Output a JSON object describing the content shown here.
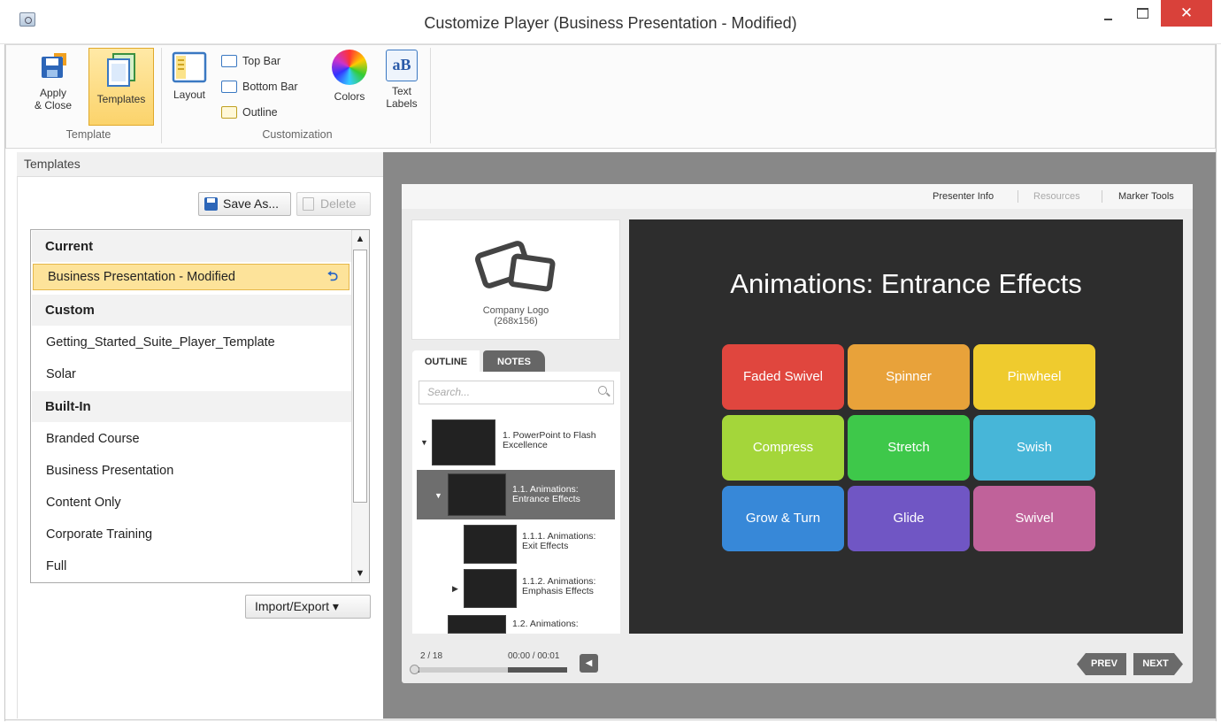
{
  "window": {
    "title": "Customize Player (Business Presentation - Modified)",
    "close_glyph": "✕"
  },
  "ribbon": {
    "apply_close": "Apply\n& Close",
    "templates": "Templates",
    "layout": "Layout",
    "top_bar": "Top Bar",
    "bottom_bar": "Bottom Bar",
    "outline": "Outline",
    "colors": "Colors",
    "text_labels": "Text\nLabels",
    "group_template": "Template",
    "group_customization": "Customization"
  },
  "templates_panel": {
    "title": "Templates",
    "save_as": "Save As...",
    "delete": "Delete",
    "import_export": "Import/Export ▾",
    "sections": {
      "current": "Current",
      "custom": "Custom",
      "built_in": "Built-In"
    },
    "current_item": "Business Presentation - Modified",
    "custom_items": [
      "Getting_Started_Suite_Player_Template",
      "Solar"
    ],
    "built_in_items": [
      "Branded Course",
      "Business Presentation",
      "Content Only",
      "Corporate Training",
      "Full"
    ]
  },
  "player": {
    "top_tabs": [
      "Presenter Info",
      "Resources",
      "Marker Tools"
    ],
    "logo_label": "Company Logo\n(268x156)",
    "tab_outline": "OUTLINE",
    "tab_notes": "NOTES",
    "search_placeholder": "Search...",
    "outline_items": [
      "1. PowerPoint to Flash\nExcellence",
      "1.1. Animations:\nEntrance Effects",
      "1.1.1. Animations:\nExit Effects",
      "1.1.2. Animations:\nEmphasis Effects",
      "1.2. Animations:"
    ],
    "slide_title": "Animations: Entrance Effects",
    "tiles": [
      {
        "label": "Faded Swivel",
        "color": "#e0463e"
      },
      {
        "label": "Spinner",
        "color": "#e8a23a"
      },
      {
        "label": "Pinwheel",
        "color": "#efcb2e"
      },
      {
        "label": "Compress",
        "color": "#a4d63a"
      },
      {
        "label": "Stretch",
        "color": "#3ec84a"
      },
      {
        "label": "Swish",
        "color": "#47b6d8"
      },
      {
        "label": "Grow & Turn",
        "color": "#3788d8"
      },
      {
        "label": "Glide",
        "color": "#7056c4"
      },
      {
        "label": "Swivel",
        "color": "#c0629a"
      }
    ],
    "counter": "2 / 18",
    "time": "00:00 / 00:01",
    "prev": "PREV",
    "next": "NEXT"
  }
}
